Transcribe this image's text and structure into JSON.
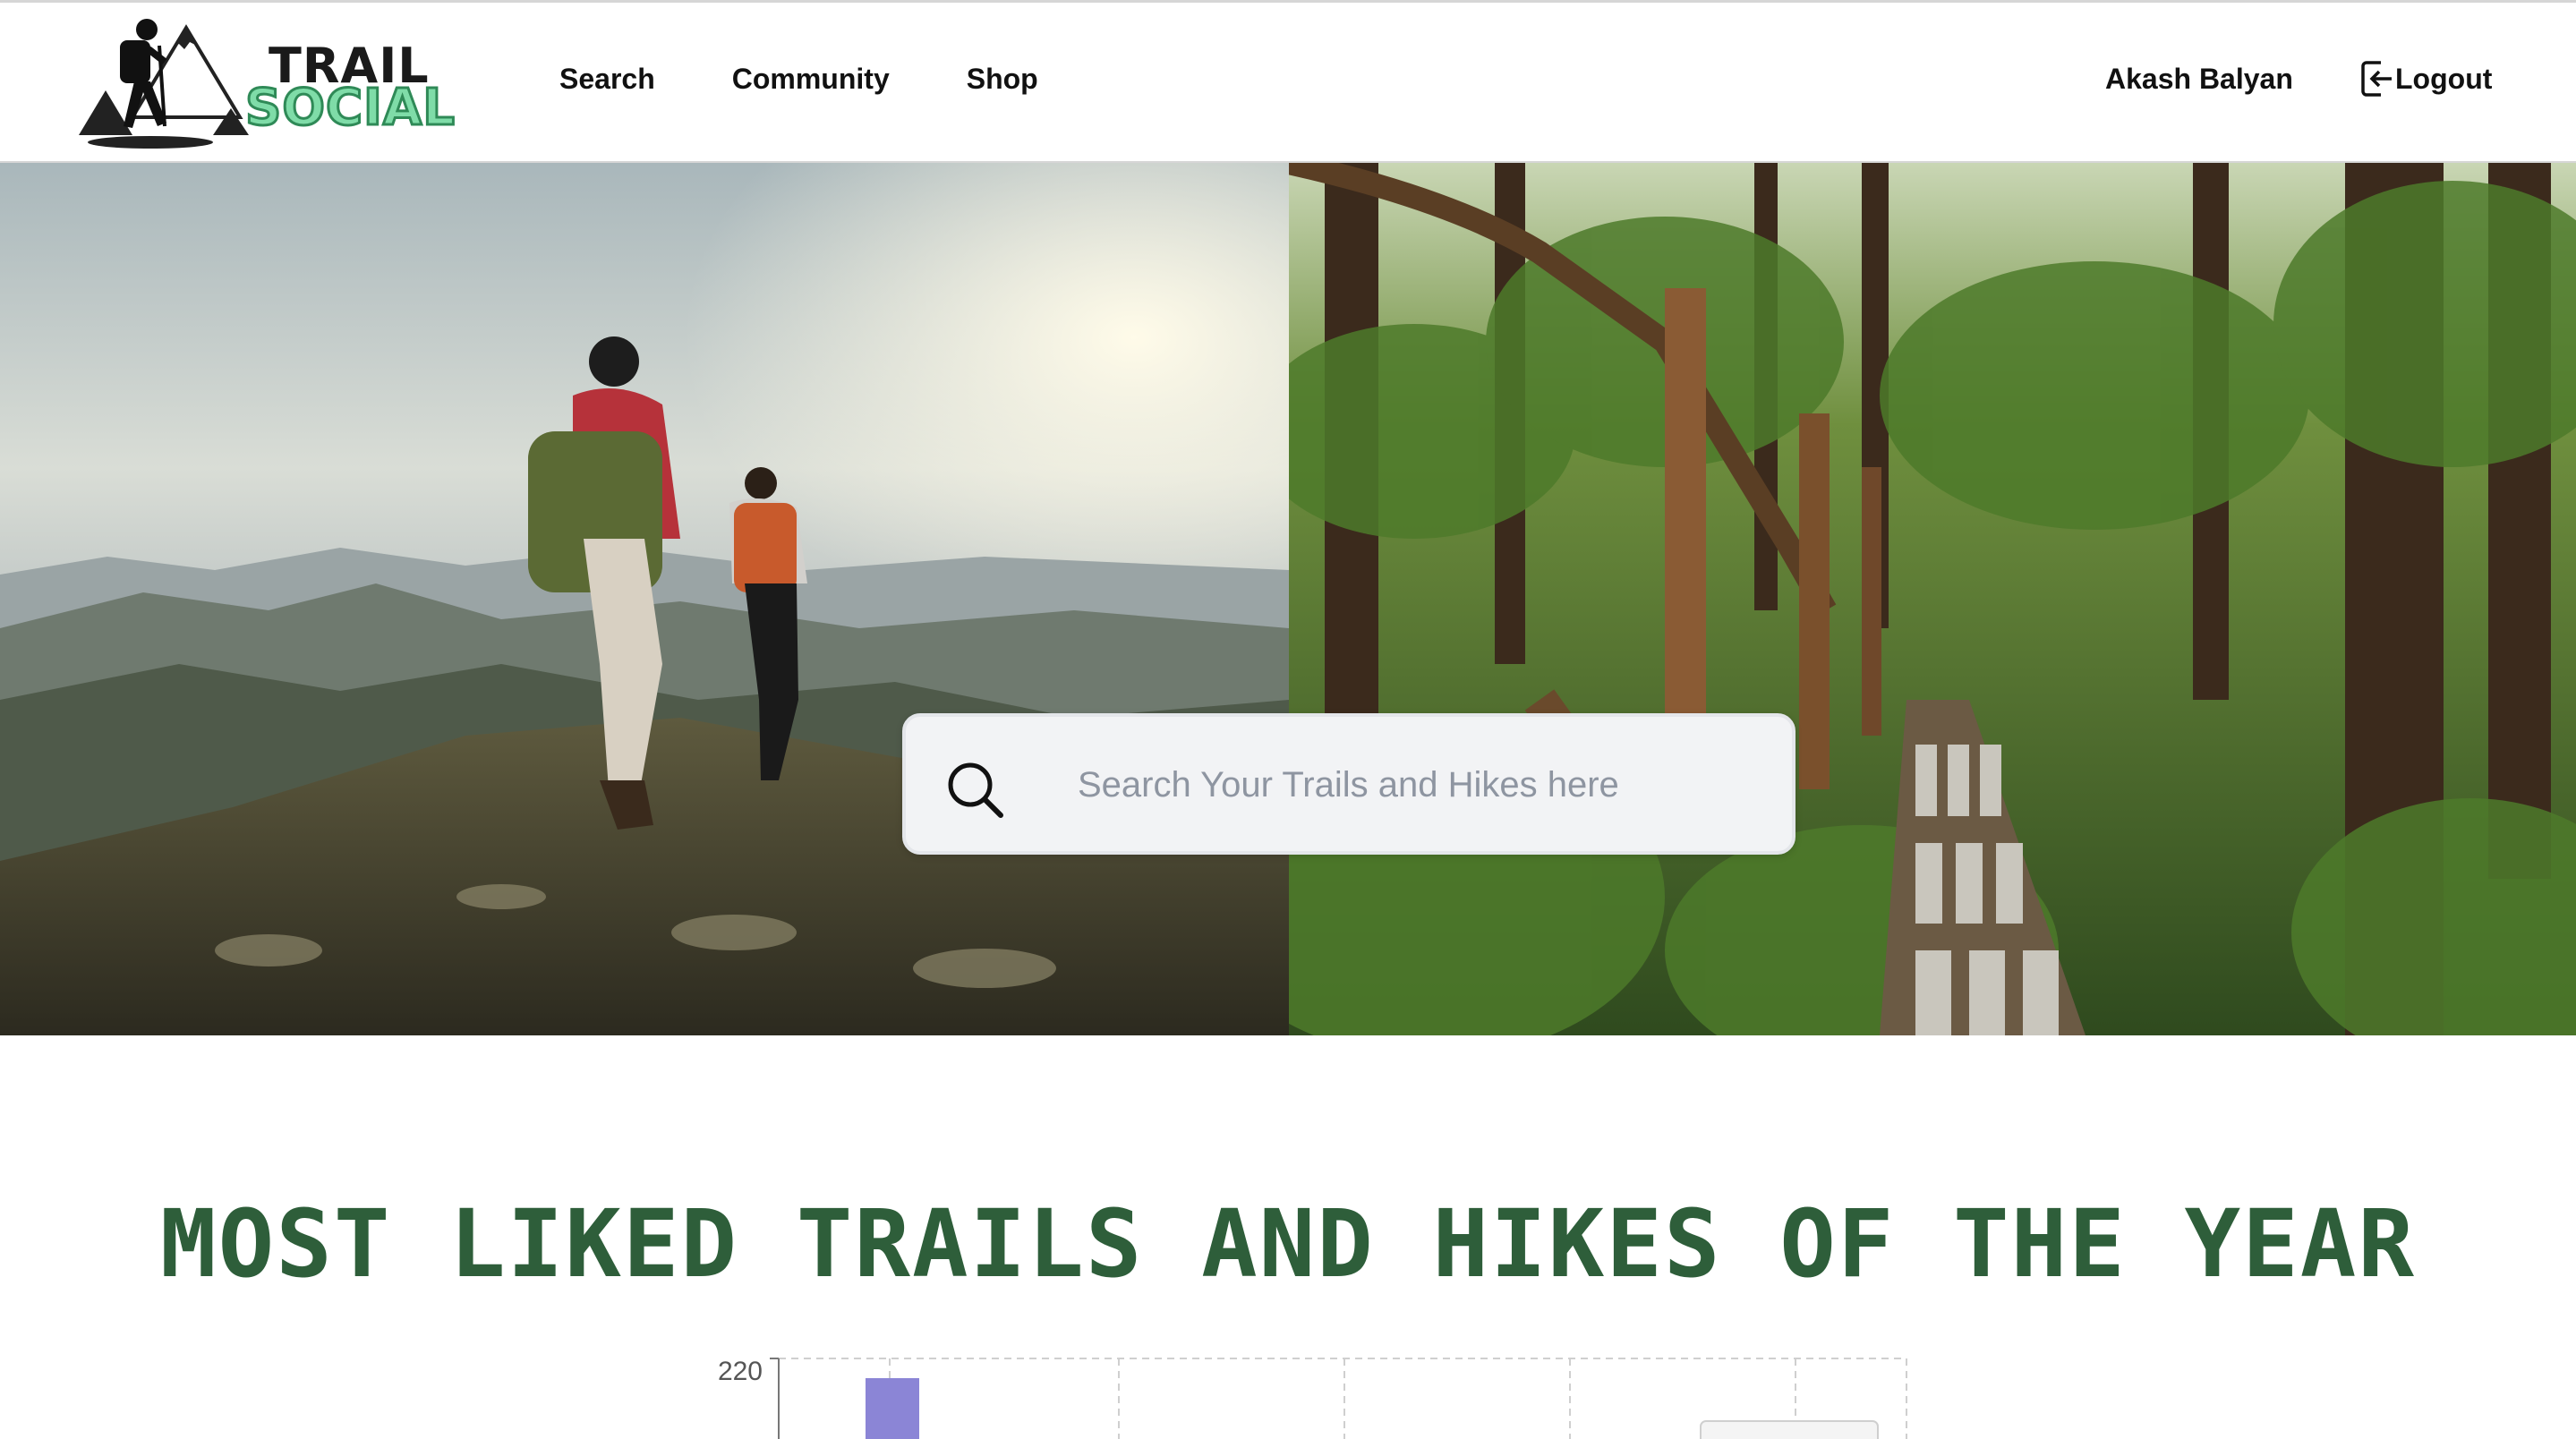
{
  "header": {
    "logo": {
      "line1": "TRAIL",
      "line2": "SOCIAL"
    },
    "nav": [
      {
        "label": "Search"
      },
      {
        "label": "Community"
      },
      {
        "label": "Shop"
      }
    ],
    "user_name": "Akash Balyan",
    "logout_label": "Logout"
  },
  "hero": {
    "search": {
      "placeholder": "Search Your Trails and Hikes here",
      "value": ""
    }
  },
  "section": {
    "title": "MOST LIKED TRAILS AND HIKES OF THE YEAR"
  },
  "chart_data": {
    "type": "bar",
    "yticks": [
      "220"
    ],
    "ylim_top": 220,
    "series_color": "#8b85d6",
    "visible_bars": [
      220
    ],
    "grid": "dashed"
  },
  "colors": {
    "title_green": "#2e5e3a",
    "logo_green": "#7fdca8",
    "bar": "#8b85d6"
  }
}
